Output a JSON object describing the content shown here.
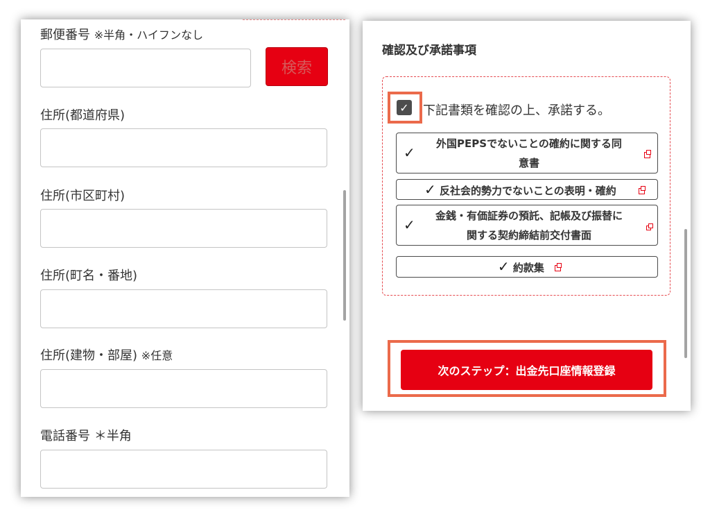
{
  "address_form": {
    "postal_code_label": "郵便番号",
    "postal_code_note": "※半角・ハイフンなし",
    "search_button_label": "検索",
    "prefecture_label": "住所(都道府県)",
    "city_label": "住所(市区町村)",
    "street_label": "住所(町名・番地)",
    "building_label": "住所(建物・部屋)",
    "building_note": "※任意",
    "phone_label": "電話番号",
    "phone_note": "＊半角",
    "postal_code_value": "",
    "prefecture_value": "",
    "city_value": "",
    "street_value": "",
    "building_value": "",
    "phone_value": ""
  },
  "consent": {
    "section_title": "確認及び承諾事項",
    "agree_checked": true,
    "agree_label": "下記書類を確認の上、承諾する。",
    "documents": [
      {
        "line1": "外国PEPSでないことの確約に関する同",
        "line2": "意書",
        "icon": "external-link-icon"
      },
      {
        "line1": "反社会的勢力でないことの表明・確約",
        "icon": "external-link-icon"
      },
      {
        "line1": "金銭・有価証券の預託、記帳及び振替に",
        "line2": "関する契約締結前交付書面",
        "icon": "external-link-icon"
      },
      {
        "line1": "約款集",
        "icon": "external-link-icon"
      }
    ],
    "next_button_label": "次のステップ：出金先口座情報登録"
  },
  "colors": {
    "accent_red": "#e60012",
    "highlight_orange": "#eb6a4b",
    "dashed_border": "#e5484d"
  }
}
